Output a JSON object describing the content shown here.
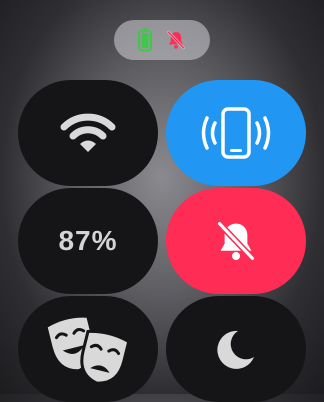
{
  "status": {
    "battery_indicator_color": "#3ec84a",
    "silent_indicator_color": "#ff2d55"
  },
  "tiles": {
    "wifi": {
      "icon": "wifi-icon",
      "bg": "#151517"
    },
    "ping_iphone": {
      "icon": "iphone-ping-icon",
      "bg": "#2196f3"
    },
    "battery": {
      "label": "87%",
      "bg": "#151517"
    },
    "silent_mode": {
      "icon": "bell-slash-icon",
      "bg": "#ff2d55"
    },
    "theater_mode": {
      "icon": "theater-masks-icon",
      "bg": "#151517"
    },
    "do_not_disturb": {
      "icon": "moon-icon",
      "bg": "#151517"
    }
  }
}
